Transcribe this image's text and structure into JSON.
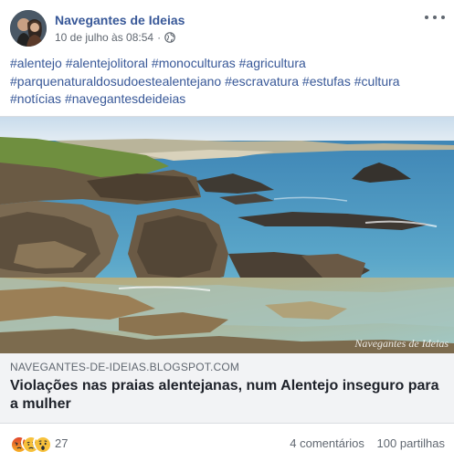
{
  "post": {
    "author": "Navegantes de Ideias",
    "timestamp": "10 de julho às 08:54",
    "separator": "·",
    "privacy_icon": "globe-icon",
    "more_icon": "more-options-icon",
    "hashtags": [
      "#alentejo",
      "#alentejolitoral",
      "#monoculturas",
      "#agricultura",
      "#parquenaturaldosudoestealentejano",
      "#escravatura",
      "#estufas",
      "#cultura",
      "#notícias",
      "#navegantesdeideias"
    ]
  },
  "link_preview": {
    "domain": "NAVEGANTES-DE-IDEIAS.BLOGSPOT.COM",
    "title": "Violações nas praias alentejanas, num Alentejo inseguro para a mulher",
    "image_watermark": "Navegantes de Ideias"
  },
  "footer": {
    "reactions": [
      "angry-reaction-icon",
      "sad-reaction-icon",
      "wow-reaction-icon"
    ],
    "reaction_count": "27",
    "comments": "4 comentários",
    "shares": "100 partilhas"
  },
  "colors": {
    "link": "#385898",
    "secondary_text": "#606770",
    "preview_bg": "#f2f3f5",
    "angry": "#e9710f",
    "sad": "#f7b125",
    "wow": "#f7b125"
  }
}
